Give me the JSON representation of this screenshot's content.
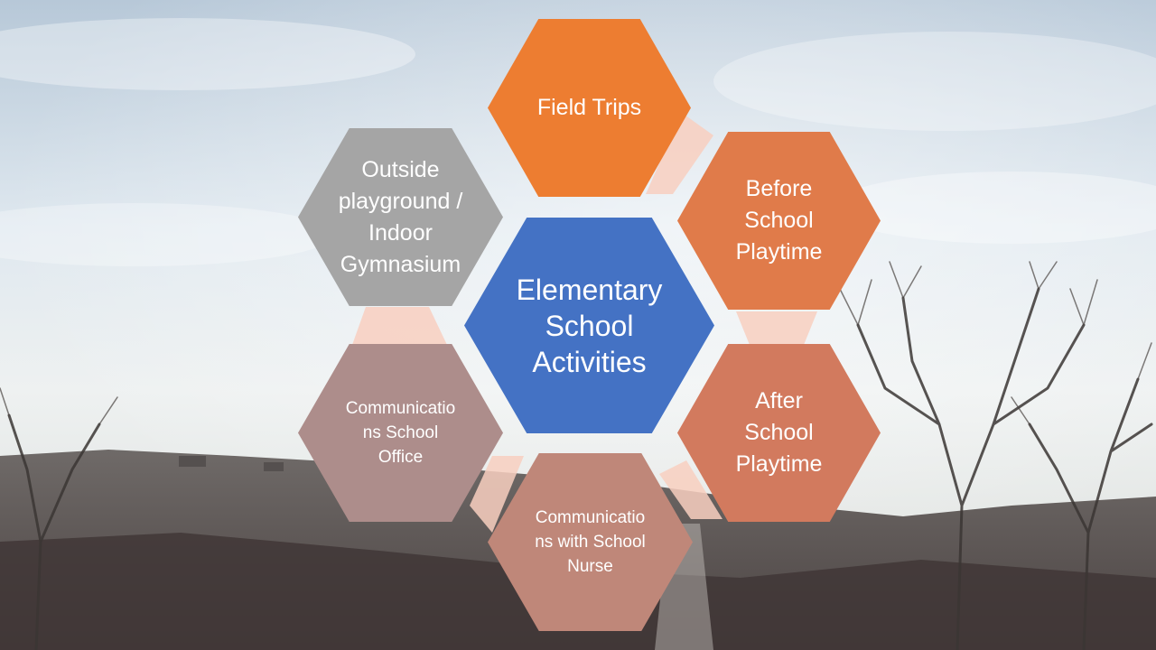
{
  "diagram": {
    "center": {
      "label": "Elementary\nSchool\nActivities",
      "color": "#4472c4"
    },
    "nodes": [
      {
        "id": "field-trips",
        "label": "Field Trips",
        "color": "#ed7d31"
      },
      {
        "id": "before-school",
        "label": "Before\nSchool\nPlaytime",
        "color": "#e07b4a"
      },
      {
        "id": "after-school",
        "label": "After\nSchool\nPlaytime",
        "color": "#d27a5e"
      },
      {
        "id": "nurse",
        "label": "Communicatio\nns with School\nNurse",
        "color": "#bf8779"
      },
      {
        "id": "office",
        "label": "Communicatio\nns School\nOffice",
        "color": "#ad8d8b"
      },
      {
        "id": "playground",
        "label": "Outside\nplayground /\nIndoor\nGymnasium",
        "color": "#a5a5a5"
      }
    ],
    "connector_color": "#f8cfc0"
  }
}
